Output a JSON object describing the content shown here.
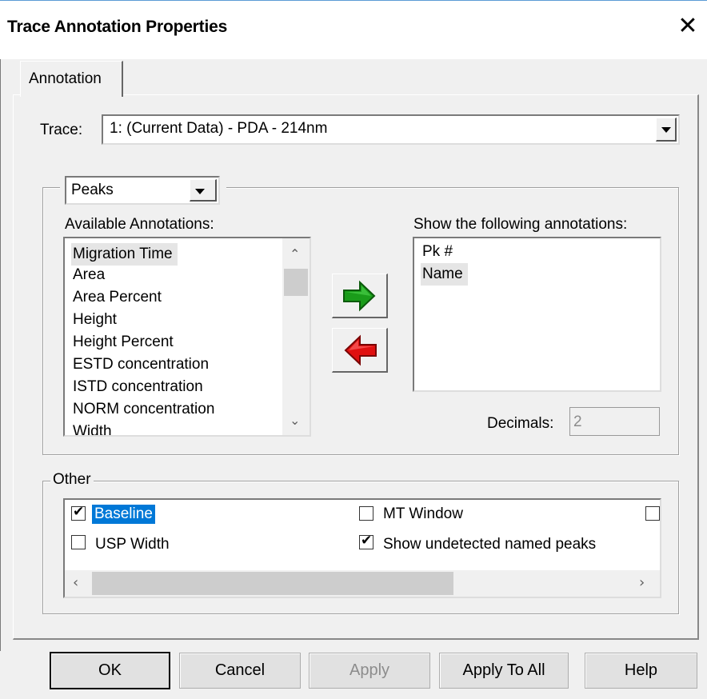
{
  "dialog": {
    "title": "Trace Annotation Properties",
    "close_icon": "close-icon"
  },
  "tabs": [
    {
      "label": "Annotation",
      "active": true
    }
  ],
  "trace": {
    "label": "Trace:",
    "value": "1: (Current Data) - PDA - 214nm"
  },
  "annotation_group": {
    "type_select": "Peaks",
    "available_label": "Available Annotations:",
    "available_items": [
      "Migration Time",
      "Area",
      "Area Percent",
      "Height",
      "Height Percent",
      "ESTD concentration",
      "ISTD concentration",
      "NORM concentration",
      "Width"
    ],
    "selected_available_index": 0,
    "show_label": "Show the following annotations:",
    "show_items": [
      "Pk #",
      "Name"
    ],
    "selected_show_index": 1,
    "add_icon": "green-right-arrow-icon",
    "remove_icon": "red-left-arrow-icon",
    "decimals_label": "Decimals:",
    "decimals_value": "2"
  },
  "other_group": {
    "legend": "Other",
    "checkboxes": [
      {
        "label": "Baseline",
        "checked": true,
        "focused": true
      },
      {
        "label": "MT Window",
        "checked": false
      },
      {
        "label": "USP Width",
        "checked": false
      },
      {
        "label": "Show undetected named peaks",
        "checked": true
      }
    ]
  },
  "buttons": {
    "ok": "OK",
    "cancel": "Cancel",
    "apply": "Apply",
    "apply_all": "Apply To All",
    "help": "Help"
  }
}
